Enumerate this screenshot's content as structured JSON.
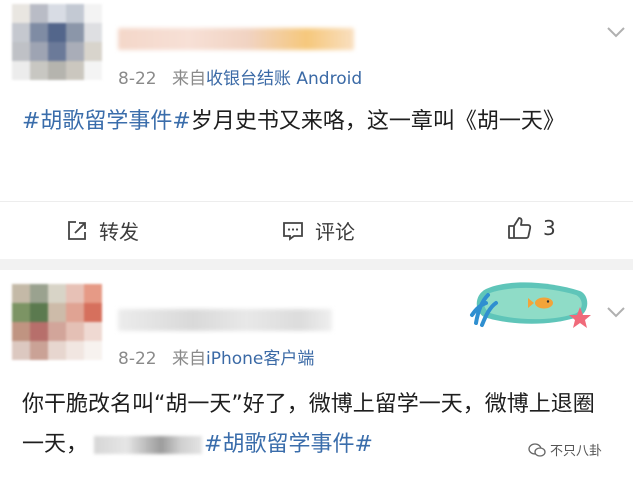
{
  "post1": {
    "date": "8-22",
    "source_prefix": "来自",
    "source": "收银台结账 Android",
    "hashtag": "#胡歌留学事件#",
    "text": "岁月史书又来咯，这一章叫《胡一天》",
    "actions": {
      "repost": "转发",
      "comment": "评论",
      "like_count": "3"
    }
  },
  "post2": {
    "date": "8-22",
    "source_prefix": "来自",
    "source": "iPhone客户端",
    "text": "你干脆改名叫“胡一天”好了，微博上留学一天，微博上退圈一天，",
    "hashtag": "#胡歌留学事件#"
  },
  "watermark": "不只八卦",
  "colors": {
    "link": "#3a6dab",
    "meta": "#8a8a8a",
    "separator": "#f2f2f2"
  },
  "icons": [
    "repost-icon",
    "comment-icon",
    "like-icon",
    "chevron-down-icon",
    "wechat-icon"
  ]
}
